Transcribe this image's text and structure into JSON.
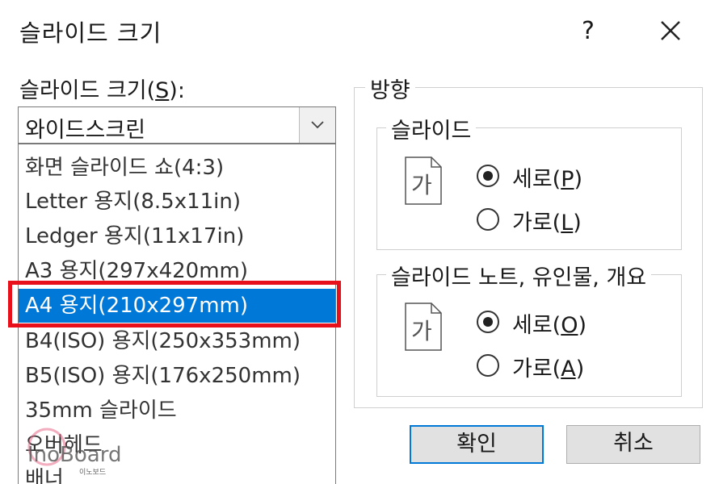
{
  "window": {
    "title": "슬라이드 크기",
    "help_label": "?"
  },
  "slide_size": {
    "label_prefix": "슬라이드 크기(",
    "label_key": "S",
    "label_suffix": "):",
    "selected_value": "와이드스크린",
    "options": [
      "화면 슬라이드 쇼(4:3)",
      "Letter 용지(8.5x11in)",
      "Ledger 용지(11x17in)",
      "A3 용지(297x420mm)",
      "A4 용지(210x297mm)",
      "B4(ISO) 용지(250x353mm)",
      "B5(ISO) 용지(176x250mm)",
      "35mm 슬라이드",
      "오버헤드",
      "배너"
    ],
    "highlighted_option": "A4 용지(210x297mm)"
  },
  "orientation": {
    "title": "방향",
    "slides": {
      "title": "슬라이드",
      "icon_char": "가",
      "portrait_prefix": "세로(",
      "portrait_key": "P",
      "portrait_suffix": ")",
      "landscape_prefix": "가로(",
      "landscape_key": "L",
      "landscape_suffix": ")",
      "selected": "portrait"
    },
    "notes": {
      "title": "슬라이드 노트, 유인물, 개요",
      "icon_char": "가",
      "portrait_prefix": "세로(",
      "portrait_key": "O",
      "portrait_suffix": ")",
      "landscape_prefix": "가로(",
      "landscape_key": "A",
      "landscape_suffix": ")",
      "selected": "portrait"
    }
  },
  "buttons": {
    "ok": "확인",
    "cancel": "취소"
  },
  "watermark": {
    "text": "InoBoard",
    "sub": "이노보드"
  },
  "colors": {
    "selection": "#0078d7",
    "highlight_border": "#e8101a"
  }
}
